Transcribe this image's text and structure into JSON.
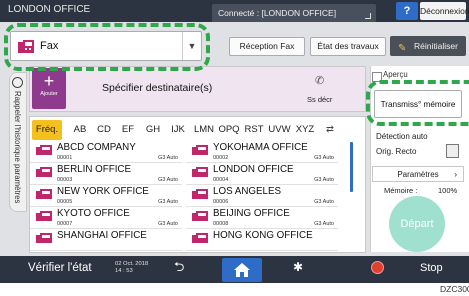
{
  "topbar": {
    "office": "LONDON OFFICE",
    "connected": "Connecté : [LONDON OFFICE]",
    "help": "?",
    "logout": "Déconnexion"
  },
  "mode": {
    "label": "Fax"
  },
  "buttons": {
    "reception": "Réception Fax",
    "jobs": "État des travaux",
    "reset": "Réinitialiser"
  },
  "destination": {
    "add": "Ajouter",
    "title": "Spécifier destinataire(s)",
    "manual": "Ss décr"
  },
  "history_tab": "Rappeler l'historique paramètres",
  "tabs": [
    "Fréq.",
    "AB",
    "CD",
    "EF",
    "GH",
    "IJK",
    "LMN",
    "OPQ",
    "RST",
    "UVW",
    "XYZ"
  ],
  "entries": [
    {
      "name": "ABCD COMPANY",
      "num": "00001",
      "mode": "G3 Auto"
    },
    {
      "name": "YOKOHAMA OFFICE",
      "num": "00002",
      "mode": "G3 Auto"
    },
    {
      "name": "BERLIN OFFICE",
      "num": "00003",
      "mode": "G3 Auto"
    },
    {
      "name": "LONDON OFFICE",
      "num": "00004",
      "mode": "G3 Auto"
    },
    {
      "name": "NEW YORK OFFICE",
      "num": "00005",
      "mode": "G3 Auto"
    },
    {
      "name": "LOS ANGELES",
      "num": "00006",
      "mode": "G3 Auto"
    },
    {
      "name": "KYOTO OFFICE",
      "num": "00007",
      "mode": "G3 Auto"
    },
    {
      "name": "BEIJING OFFICE",
      "num": "00008",
      "mode": "G3 Auto"
    },
    {
      "name": "SHANGHAI  OFFICE",
      "num": "",
      "mode": ""
    },
    {
      "name": "HONG KONG OFFICE",
      "num": "",
      "mode": ""
    }
  ],
  "right": {
    "apercu": "Aperçu",
    "transmiss": "Transmiss° mémoire",
    "detect": "Détection auto",
    "orig": "Orig. Recto",
    "params": "Paramètres",
    "memoire": "Mémoire :",
    "memoire_val": "100%",
    "depart": "Départ"
  },
  "bottom": {
    "verify": "Vérifier l'état",
    "date": "02 Oct. 2018",
    "time": "14 : 53",
    "stop": "Stop"
  },
  "code": "DZC300",
  "colors": {
    "accent": "#2ea84a",
    "active_tab": "#f3c01e",
    "add": "#8e3b8d",
    "depart": "#9fe0cf"
  }
}
